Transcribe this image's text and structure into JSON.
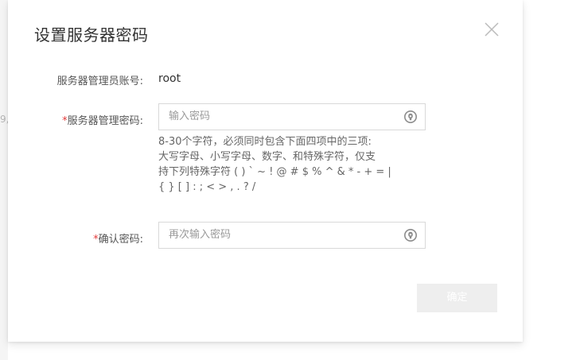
{
  "backdrop": {
    "fragment": "9,"
  },
  "dialog": {
    "title": "设置服务器密码",
    "close_icon": "close-icon"
  },
  "form": {
    "admin_account": {
      "label": "服务器管理员账号:",
      "value": "root"
    },
    "password": {
      "required_mark": "*",
      "label": "服务器管理密码:",
      "placeholder": "输入密码",
      "visibility_icon": "eye-icon",
      "hint_lines": [
        "8-30个字符，必须同时包含下面四项中的三项:",
        "大写字母、小写字母、数字、和特殊字符，仅支",
        "持下列特殊字符 ( ) ` ~ ! @ # $ % ^ & * - + = |",
        "{ } [ ] : ; < > , . ? /"
      ]
    },
    "confirm_password": {
      "required_mark": "*",
      "label": "确认密码:",
      "placeholder": "再次输入密码",
      "visibility_icon": "eye-icon"
    }
  },
  "footer": {
    "confirm_label": "确定"
  },
  "colors": {
    "required": "#e33b3b",
    "disabled_button_bg": "#eeeeee",
    "input_border": "#d9d9d9",
    "placeholder": "#9a9a9a"
  }
}
